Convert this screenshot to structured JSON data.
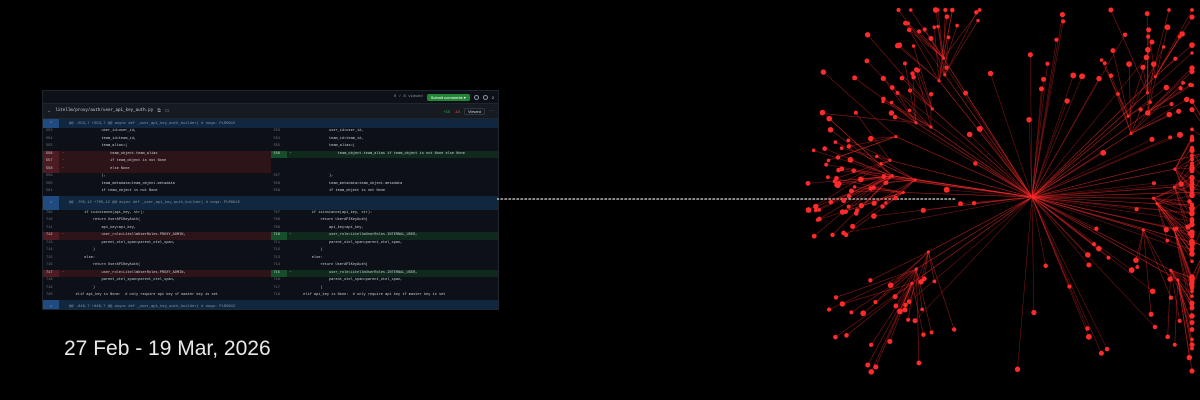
{
  "topbar": {
    "viewed": "0 / 8 viewed",
    "submit": "Submit comments ▾",
    "count": "2"
  },
  "file": {
    "path": "litellm/proxy/auth/user_api_key_auth.py",
    "additions": "+10",
    "deletions": "-10",
    "viewed_label": "Viewed"
  },
  "hunks": [
    {
      "expand": "↕",
      "text": "@@ -553,7 +553,7 @@ async def _user_api_key_auth_builder( # noqa: PLR0915"
    },
    {
      "expand": "↕",
      "text": "@@ -705,12 +705,12 @@ async def _user_api_key_auth_builder( # noqa: PLR0915"
    },
    {
      "expand": "↕",
      "text": "@@ -846,7 +846,7 @@ async def _user_api_key_auth_builder( # noqa: PLR0915"
    }
  ],
  "block1": [
    {
      "l": {
        "t": "ctx",
        "n": "553",
        "c": "                user_id=user_id,"
      },
      "r": {
        "t": "ctx",
        "n": "553",
        "c": "                user_id=user_id,"
      }
    },
    {
      "l": {
        "t": "ctx",
        "n": "554",
        "c": "                team_id=team_id,"
      },
      "r": {
        "t": "ctx",
        "n": "554",
        "c": "                team_id=team_id,"
      }
    },
    {
      "l": {
        "t": "ctx",
        "n": "555",
        "c": "                team_alias=("
      },
      "r": {
        "t": "ctx",
        "n": "555",
        "c": "                team_alias=("
      }
    },
    {
      "l": {
        "t": "del",
        "n": "556",
        "c": "                    team_object.team_alias"
      },
      "r": {
        "t": "add",
        "n": "556",
        "c": "                    team_object.team_alias if team_object is not None else None"
      }
    },
    {
      "l": {
        "t": "del",
        "n": "557",
        "c": "                    if team_object is not None"
      },
      "r": {
        "t": "empty",
        "n": "",
        "c": ""
      }
    },
    {
      "l": {
        "t": "del",
        "n": "558",
        "c": "                    else None"
      },
      "r": {
        "t": "empty",
        "n": "",
        "c": ""
      }
    },
    {
      "l": {
        "t": "ctx",
        "n": "559",
        "c": "                ),"
      },
      "r": {
        "t": "ctx",
        "n": "557",
        "c": "                ),"
      }
    },
    {
      "l": {
        "t": "ctx",
        "n": "560",
        "c": "                team_metadata=team_object.metadata"
      },
      "r": {
        "t": "ctx",
        "n": "558",
        "c": "                team_metadata=team_object.metadata"
      }
    },
    {
      "l": {
        "t": "ctx",
        "n": "561",
        "c": "                if team_object is not None"
      },
      "r": {
        "t": "ctx",
        "n": "559",
        "c": "                if team_object is not None"
      }
    }
  ],
  "block2": [
    {
      "l": {
        "t": "ctx",
        "n": "709",
        "c": "        if isinstance(api_key, str):"
      },
      "r": {
        "t": "ctx",
        "n": "707",
        "c": "        if isinstance(api_key, str):"
      }
    },
    {
      "l": {
        "t": "ctx",
        "n": "710",
        "c": "            return UserAPIKeyAuth("
      },
      "r": {
        "t": "ctx",
        "n": "708",
        "c": "            return UserAPIKeyAuth("
      }
    },
    {
      "l": {
        "t": "ctx",
        "n": "711",
        "c": "                api_key=api_key,"
      },
      "r": {
        "t": "ctx",
        "n": "709",
        "c": "                api_key=api_key,"
      }
    },
    {
      "l": {
        "t": "del",
        "n": "712",
        "c": "                user_role=LitellmUserRoles.PROXY_ADMIN,"
      },
      "r": {
        "t": "add",
        "n": "710",
        "c": "                user_role=LitellmUserRoles.INTERNAL_USER,"
      }
    },
    {
      "l": {
        "t": "ctx",
        "n": "713",
        "c": "                parent_otel_span=parent_otel_span,"
      },
      "r": {
        "t": "ctx",
        "n": "711",
        "c": "                parent_otel_span=parent_otel_span,"
      }
    },
    {
      "l": {
        "t": "ctx",
        "n": "714",
        "c": "            )"
      },
      "r": {
        "t": "ctx",
        "n": "712",
        "c": "            )"
      }
    },
    {
      "l": {
        "t": "ctx",
        "n": "715",
        "c": "        else:"
      },
      "r": {
        "t": "ctx",
        "n": "713",
        "c": "        else:"
      }
    },
    {
      "l": {
        "t": "ctx",
        "n": "716",
        "c": "            return UserAPIKeyAuth("
      },
      "r": {
        "t": "ctx",
        "n": "714",
        "c": "            return UserAPIKeyAuth("
      }
    },
    {
      "l": {
        "t": "del",
        "n": "717",
        "c": "                user_role=LitellmUserRoles.PROXY_ADMIN,"
      },
      "r": {
        "t": "add",
        "n": "715",
        "c": "                user_role=LitellmUserRoles.INTERNAL_USER,"
      }
    },
    {
      "l": {
        "t": "ctx",
        "n": "718",
        "c": "                parent_otel_span=parent_otel_span,"
      },
      "r": {
        "t": "ctx",
        "n": "716",
        "c": "                parent_otel_span=parent_otel_span,"
      }
    },
    {
      "l": {
        "t": "ctx",
        "n": "719",
        "c": "            )"
      },
      "r": {
        "t": "ctx",
        "n": "717",
        "c": "            )"
      }
    },
    {
      "l": {
        "t": "ctx",
        "n": "720",
        "c": "    elif api_key is None:  # only require api key if master key is set"
      },
      "r": {
        "t": "ctx",
        "n": "718",
        "c": "    elif api_key is None:  # only require api key if master key is set"
      }
    }
  ],
  "date_range": "27 Feb - 19 Mar, 2026",
  "colors": {
    "background": "#000000",
    "graph_red": "#ff2a2a",
    "connector": "#bbbbbb"
  }
}
